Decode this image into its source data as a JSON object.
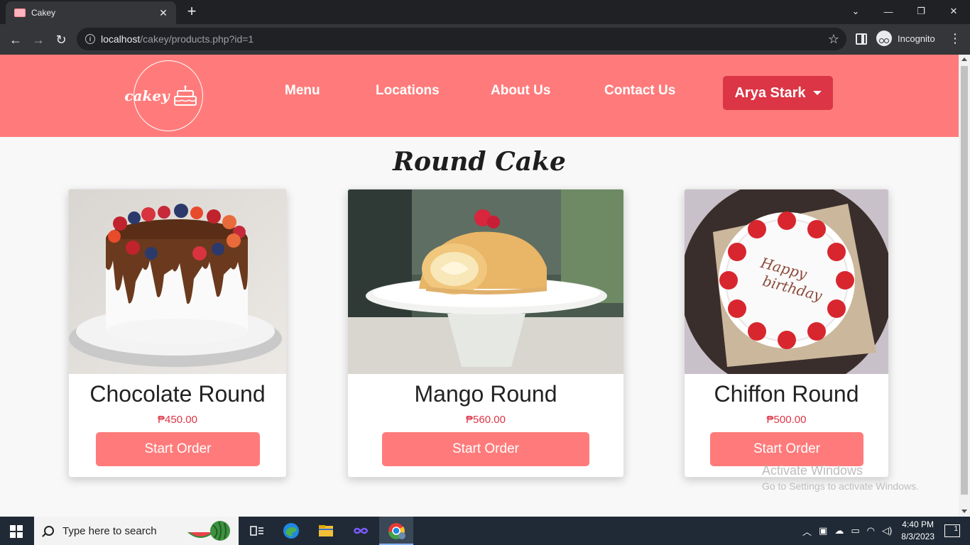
{
  "browser": {
    "tab_title": "Cakey",
    "url_host": "localhost",
    "url_path": "/cakey/products.php?id=1",
    "incognito_label": "Incognito"
  },
  "site": {
    "logo_text": "cakey",
    "nav": [
      "Menu",
      "Locations",
      "About Us",
      "Contact Us"
    ],
    "user_name": "Arya Stark",
    "page_title": "Round Cake",
    "accent_color": "#ff7b7b",
    "button_color": "#dc3545"
  },
  "products": [
    {
      "name": "Chocolate Round",
      "price": "₱450.00",
      "button": "Start Order",
      "image": "chocolate-drip-cake"
    },
    {
      "name": "Mango Round",
      "price": "₱560.00",
      "button": "Start Order",
      "image": "roll-cake-on-stand"
    },
    {
      "name": "Chiffon Round",
      "price": "₱500.00",
      "button": "Start Order",
      "image": "strawberry-birthday-cake"
    }
  ],
  "watermark": {
    "title": "Activate Windows",
    "subtitle": "Go to Settings to activate Windows."
  },
  "taskbar": {
    "search_placeholder": "Type here to search",
    "time": "4:40 PM",
    "date": "8/3/2023",
    "notification_count": "1"
  }
}
